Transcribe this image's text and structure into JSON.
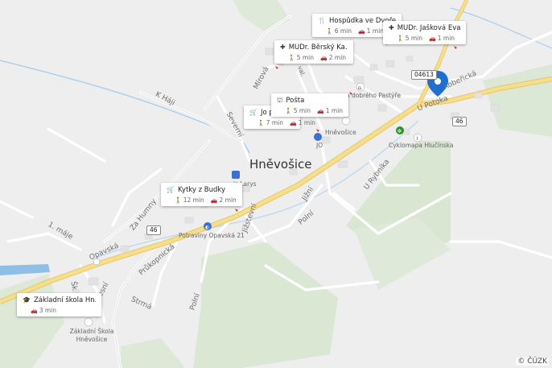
{
  "map": {
    "place_label": "Hněvošice",
    "copyright": "© ČÚZK",
    "road_numbers": {
      "road_46_a": "46",
      "road_46_b": "46",
      "road_04613": "04613"
    },
    "streets": {
      "k_haji": "K Háji",
      "mirova": "Mírová",
      "severni": "Severní",
      "za_humny": "Za Humny",
      "jedna_maje": "1. máje",
      "opavska": "Opavská",
      "prukopnicka": "Průkopnická",
      "lesni": "Lesní",
      "strma": "Strmá",
      "polni_a": "Polní",
      "polni_b": "Polní",
      "jizni": "Jižní",
      "u_rybnika": "U Rybníka",
      "u_potoka": "U Potoka",
      "koberecka": "Kobeřická",
      "zizstevni": "Jižstevní",
      "skolni": "Šk"
    },
    "pois": {
      "hnevosice_station": "Hněvošice",
      "cyklomapa": "Cyklomapa Hlučínska",
      "potraviny": "Potraviny Opavská 21",
      "zakladni_skola_label": "Základní Škola Hněvošice",
      "jo_label": "JO",
      "dobreho_pastyre": "a dobrého Pastýře",
      "lorys": "is Larys",
      "ivalk": "val."
    }
  },
  "cards": [
    {
      "id": "hospudka",
      "icon": "restaurant-icon",
      "title": "Hospůdka ve Dvoře",
      "walk": "6 min",
      "car": "1 min"
    },
    {
      "id": "jaskova",
      "icon": "medical-icon",
      "title": "MUDr. Jašková Eva",
      "walk": "5 min",
      "car": "1 min"
    },
    {
      "id": "bersky",
      "icon": "medical-icon",
      "title": "MUDr. Běrský Ka…",
      "walk": "5 min",
      "car": "2 min"
    },
    {
      "id": "posta",
      "icon": "post-office-icon",
      "title": "Pošta",
      "walk": "5 min",
      "car": "1 min"
    },
    {
      "id": "jo",
      "icon": "shop-icon",
      "title": "Jo po",
      "walk": "7 min",
      "car": "1 min"
    },
    {
      "id": "kytky",
      "icon": "shop-icon",
      "title": "Kytky z Budky",
      "walk": "12 min",
      "car": "2 min"
    },
    {
      "id": "skola",
      "icon": "school-icon",
      "title": "Základní škola Hn…",
      "walk": "",
      "car": "3 min"
    }
  ]
}
